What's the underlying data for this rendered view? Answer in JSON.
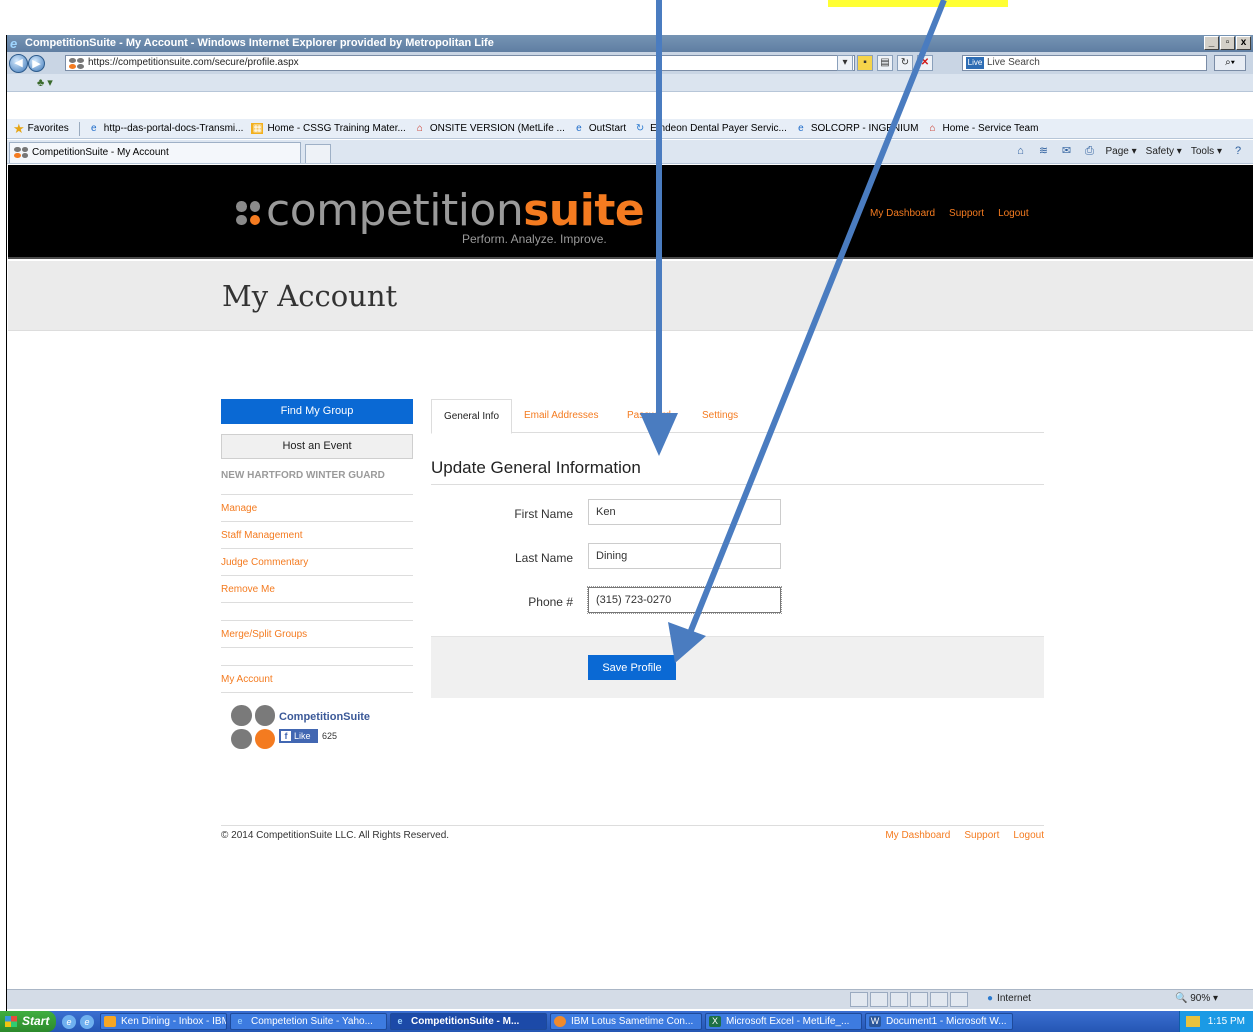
{
  "window": {
    "title": "CompetitionSuite - My Account - Windows Internet Explorer provided by Metropolitan Life",
    "controls": [
      "_",
      "▫",
      "x"
    ]
  },
  "address_bar": {
    "url": "https://competitionsuite.com/secure/profile.aspx",
    "search_placeholder": "Live Search"
  },
  "favorites_bar": {
    "label": "Favorites",
    "links": [
      {
        "icon": "ie-icon",
        "label": "http--das-portal-docs-Transmi..."
      },
      {
        "icon": "sheet-icon",
        "label": "Home - CSSG Training Mater..."
      },
      {
        "icon": "house-icon",
        "label": "ONSITE VERSION (MetLife ..."
      },
      {
        "icon": "ie-icon",
        "label": "OutStart"
      },
      {
        "icon": "recycle-icon",
        "label": "Emdeon Dental Payer Servic..."
      },
      {
        "icon": "ie-icon",
        "label": "SOLCORP - INGENIUM"
      },
      {
        "icon": "house-icon",
        "label": "Home - Service Team"
      }
    ]
  },
  "browser_tab": {
    "label": "CompetitionSuite - My Account"
  },
  "command_bar": {
    "page": "Page",
    "safety": "Safety",
    "tools": "Tools"
  },
  "site": {
    "logo_word_gray": "competition",
    "logo_word_orange": "suite",
    "tagline": "Perform. Analyze. Improve.",
    "header_links": [
      "My Dashboard",
      "Support",
      "Logout"
    ]
  },
  "page_title": "My Account",
  "sidebar": {
    "find_group": "Find My Group",
    "host_event": "Host an Event",
    "group_name": "NEW HARTFORD WINTER GUARD",
    "group_links": [
      "Manage",
      "Staff Management",
      "Judge Commentary",
      "Remove Me"
    ],
    "merge_split": "Merge/Split Groups",
    "my_account": "My Account",
    "fb_name": "CompetitionSuite",
    "fb_like": "Like",
    "fb_count": "625"
  },
  "tabs": [
    "General Info",
    "Email Addresses",
    "Password",
    "Settings"
  ],
  "form": {
    "heading": "Update General Information",
    "first_name_label": "First Name",
    "first_name": "Ken",
    "last_name_label": "Last Name",
    "last_name": "Dining",
    "phone_label": "Phone #",
    "phone": "(315) 723-0270",
    "save": "Save Profile"
  },
  "footer": {
    "copyright": "© 2014 CompetitionSuite LLC. All Rights Reserved.",
    "links": [
      "My Dashboard",
      "Support",
      "Logout"
    ]
  },
  "status_bar": {
    "zone": "Internet",
    "zoom": "90%"
  },
  "taskbar": {
    "start": "Start",
    "tasks": [
      {
        "label": "Ken Dining - Inbox - IBM ...",
        "active": false
      },
      {
        "label": "Competetion Suite - Yaho...",
        "active": false
      },
      {
        "label": "CompetitionSuite - M...",
        "active": true
      },
      {
        "label": "IBM Lotus Sametime Con...",
        "active": false
      },
      {
        "label": "Microsoft Excel - MetLife_...",
        "active": false
      },
      {
        "label": "Document1 - Microsoft W...",
        "active": false
      }
    ],
    "clock": "1:15 PM"
  },
  "colors": {
    "accent_orange": "#f47b20",
    "button_blue": "#0a69d4",
    "arrow_blue": "#4a7cc0",
    "highlight_yellow": "#ffff33"
  }
}
